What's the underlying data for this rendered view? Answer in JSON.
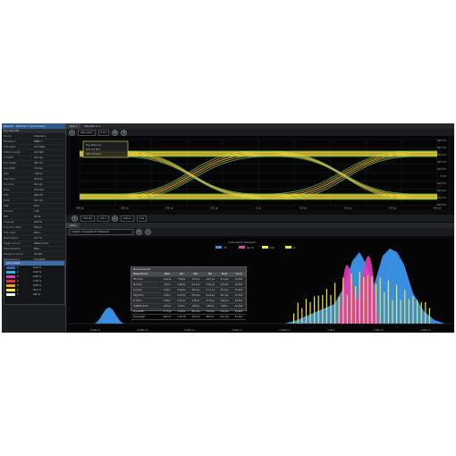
{
  "window": {
    "title": "Results - Window 1 (Overview)"
  },
  "left_panel": {
    "subheader": "Eye Results",
    "properties": [
      {
        "k": "Source",
        "v": "Channel 1"
      },
      {
        "k": "Bit Pattern",
        "v": "PRBS 7"
      },
      {
        "k": "Data Rate",
        "v": "10.3 Gb/s"
      },
      {
        "k": "Pattern Length",
        "v": "127 bits"
      },
      {
        "k": "UI Width",
        "v": "97.1 ps"
      },
      {
        "k": "Eye Height",
        "v": "392 mV"
      },
      {
        "k": "Eye Width",
        "v": "77.5 ps"
      },
      {
        "k": "Jitter",
        "v": "7.89 ps"
      },
      {
        "k": "Rise Time",
        "v": "24.8 ps"
      },
      {
        "k": "Fall Time",
        "v": "25.1 ps"
      },
      {
        "k": "Mean",
        "v": "12.0 mV"
      },
      {
        "k": "RMS",
        "v": "248 mV"
      },
      {
        "k": "Pk-Pk",
        "v": "531 mV"
      },
      {
        "k": "SNR",
        "v": "18.4"
      },
      {
        "k": "Q-factor",
        "v": "7.92"
      },
      {
        "k": "BER",
        "v": "1E-12"
      },
      {
        "k": "Crossing",
        "v": "49.8 %"
      },
      {
        "k": "TJ @ Error Rate",
        "v": "108 ps"
      },
      {
        "k": "Filter Type",
        "v": "None"
      },
      {
        "k": "Mask Margin",
        "v": "23.1 %"
      },
      {
        "k": "Trigger Source",
        "v": "Pattern Lock"
      },
      {
        "k": "Edge Selection",
        "v": "Both"
      },
      {
        "k": "Waveform Count",
        "v": "54 316"
      },
      {
        "k": "Measurement",
        "v": "Complete"
      }
    ],
    "color_table": {
      "header": "Color Grade",
      "rows": [
        {
          "label": "1",
          "pct": "0.02 %",
          "color": "#3f5fbf"
        },
        {
          "label": "2",
          "pct": "0.10 %",
          "color": "#19c1d8"
        },
        {
          "label": "3",
          "pct": "0.80 %",
          "color": "#e63ab8"
        },
        {
          "label": "4",
          "pct": "2.50 %",
          "color": "#ec2f3d"
        },
        {
          "label": "5",
          "pct": "8.00 %",
          "color": "#f5a323"
        },
        {
          "label": "6",
          "pct": "25.0 %",
          "color": "#f4e63c"
        },
        {
          "label": "7",
          "pct": "100 %",
          "color": "#f2f2f2"
        }
      ]
    }
  },
  "top": {
    "tabs": [
      "Eye 1",
      "Waveform 1"
    ],
    "toolbar": {
      "timebase": "100 ns/div",
      "offset": "0.0 V"
    },
    "tooltip": {
      "line1": "Eye Mask Cyc",
      "line2": "Test 1/2 MUI",
      "line3": "NRZ 10 Gbps"
    },
    "y_ticks": [
      "500 mV",
      "400 mV",
      "300 mV",
      "200 mV",
      "100 mV",
      "0 mV",
      "-100 mV",
      "-200 mV",
      "-300 mV",
      "-400 mV"
    ],
    "x_ticks": [
      "-400 ps",
      "-300 ps",
      "-200 ps",
      "-100 ps",
      "0 ps",
      "100 ps",
      "200 ps",
      "300 ps",
      "400 ps"
    ],
    "bottom_fields": [
      "100 mV",
      "0.0 V",
      "100 ps",
      "0 ps"
    ]
  },
  "histogram": {
    "tab": "Jitter",
    "toolbar_label": "Graphs: Composite TI Histogram",
    "title": "Composite TI Histogram",
    "legend": [
      {
        "name": "TIE",
        "color": "#3a8ee0"
      },
      {
        "name": "RJ+DJ",
        "color": "#e63ab8"
      },
      {
        "name": "DDJ",
        "color": "#f4e63c"
      },
      {
        "name": "PJ",
        "color": "#f4e63c"
      }
    ],
    "x_ticks": [
      "-5.000 ns",
      "-4.000 ns",
      "-3.000 ns",
      "-2.000 ns",
      "-1.000 ns",
      "0.00 s",
      "1.000 ns",
      "2.000 ns"
    ],
    "measurements": {
      "title": "Measurements",
      "columns": [
        "Measurement",
        "Mean",
        "Std",
        "Max",
        "Min",
        "Pk-Pk",
        "Count"
      ],
      "rows": [
        [
          "TIE (Ch1)",
          "1.20 ps",
          "7.89 ps",
          "24.5 ps",
          "-22.7 ps",
          "47.2 ps",
          "54 316"
        ],
        [
          "RJ (Ch1)",
          "0.00 s",
          "1.98 ps",
          "6.11 ps",
          "-5.90 ps",
          "12.0 ps",
          "54 316"
        ],
        [
          "DJ (Ch1)",
          "0.00 s",
          "5.44 ps",
          "18.2 ps",
          "-17.1 ps",
          "35.3 ps",
          "54 316"
        ],
        [
          "DDJ (Ch1)",
          "0.00 s",
          "4.70 ps",
          "15.9 ps",
          "-14.8 ps",
          "30.7 ps",
          "54 316"
        ],
        [
          "PJ (Ch1)",
          "0.00 s",
          "0.91 ps",
          "2.30 ps",
          "-2.10 ps",
          "4.40 ps",
          "54 316"
        ],
        [
          "TJ@BER (Ch1)",
          "108 ps",
          "0.00 s",
          "108 ps",
          "108 ps",
          "0.00 s",
          "54 316"
        ],
        [
          "Eye Width",
          "77.5 ps",
          "1.04 ps",
          "80.1 ps",
          "75.0 ps",
          "5.10 ps",
          "54 316"
        ],
        [
          "Eye Height",
          "392 mV",
          "3.10 mV",
          "401 mV",
          "383 mV",
          "18.0 mV",
          "54 316"
        ]
      ]
    }
  },
  "colors": {
    "bg": "#0b0b0c",
    "panel": "#1c1d20",
    "accent": "#3d6ea9",
    "eye_green": "#5fbf72",
    "eye_yellow": "#f4e63c",
    "eye_orange": "#f5a323",
    "hist_blue": "#3a8ee0",
    "hist_magenta": "#e63ab8"
  }
}
